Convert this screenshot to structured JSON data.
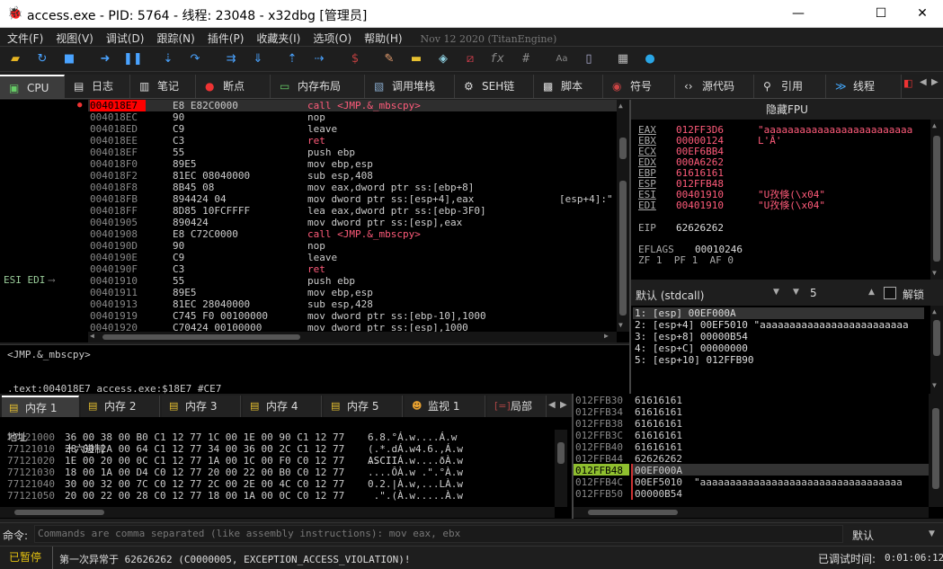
{
  "window": {
    "title": "access.exe - PID: 5764 - 线程: 23048 - x32dbg [管理员]",
    "minimize_glyph": "—",
    "maximize_glyph": "☐",
    "close_glyph": "✕"
  },
  "menu": {
    "items": [
      "文件(F)",
      "视图(V)",
      "调试(D)",
      "跟踪(N)",
      "插件(P)",
      "收藏夹(I)",
      "选项(O)",
      "帮助(H)"
    ],
    "build_date": "Nov 12 2020 (TitanEngine)"
  },
  "toolbar": {
    "icons": [
      "open-icon",
      "restart-icon",
      "stop-icon",
      "run-icon",
      "pause-icon",
      "step-into-icon",
      "step-over-icon",
      "trace-into-icon",
      "trace-over-icon",
      "execute-till-return-icon",
      "run-to-user-code-icon",
      "scylla-icon",
      "patch-icon",
      "comment-icon",
      "label-icon",
      "bookmark-icon",
      "function-icon",
      "hash-icon",
      "font-icon",
      "attach-icon",
      "calculator-icon",
      "globe-icon"
    ],
    "fx_label": "fx",
    "hash_label": "#",
    "font_label": "Aa"
  },
  "tabs": [
    {
      "label": "CPU",
      "icon": "cpu-icon"
    },
    {
      "label": "日志",
      "icon": "log-icon"
    },
    {
      "label": "笔记",
      "icon": "notes-icon"
    },
    {
      "label": "断点",
      "icon": "breakpoint-icon"
    },
    {
      "label": "内存布局",
      "icon": "memory-map-icon"
    },
    {
      "label": "调用堆栈",
      "icon": "call-stack-icon"
    },
    {
      "label": "SEH链",
      "icon": "seh-icon"
    },
    {
      "label": "脚本",
      "icon": "script-icon"
    },
    {
      "label": "符号",
      "icon": "symbol-icon"
    },
    {
      "label": "源代码",
      "icon": "source-icon"
    },
    {
      "label": "引用",
      "icon": "references-icon"
    },
    {
      "label": "线程",
      "icon": "threads-icon"
    }
  ],
  "disasm": {
    "gutter_label": "ESI EDI",
    "rows": [
      {
        "addr": "004018E7",
        "bytes": "E8 E82C0000",
        "ins": "call <JMP.&_mbscpy>",
        "kind": "call"
      },
      {
        "addr": "004018EC",
        "bytes": "90",
        "ins": "nop",
        "kind": ""
      },
      {
        "addr": "004018ED",
        "bytes": "C9",
        "ins": "leave",
        "kind": ""
      },
      {
        "addr": "004018EE",
        "bytes": "C3",
        "ins": "ret",
        "kind": "ret"
      },
      {
        "addr": "004018EF",
        "bytes": "55",
        "ins": "push ebp",
        "kind": ""
      },
      {
        "addr": "004018F0",
        "bytes": "89E5",
        "ins": "mov ebp,esp",
        "kind": ""
      },
      {
        "addr": "004018F2",
        "bytes": "81EC 08040000",
        "ins": "sub esp,408",
        "kind": ""
      },
      {
        "addr": "004018F8",
        "bytes": "8B45 08",
        "ins": "mov eax,dword ptr ss:[ebp+8]",
        "kind": ""
      },
      {
        "addr": "004018FB",
        "bytes": "894424 04",
        "ins": "mov dword ptr ss:[esp+4],eax",
        "kind": "",
        "comment": "[esp+4]:\""
      },
      {
        "addr": "004018FF",
        "bytes": "8D85 10FCFFFF",
        "ins": "lea eax,dword ptr ss:[ebp-3F0]",
        "kind": ""
      },
      {
        "addr": "00401905",
        "bytes": "890424",
        "ins": "mov dword ptr ss:[esp],eax",
        "kind": ""
      },
      {
        "addr": "00401908",
        "bytes": "E8 C72C0000",
        "ins": "call <JMP.&_mbscpy>",
        "kind": "call"
      },
      {
        "addr": "0040190D",
        "bytes": "90",
        "ins": "nop",
        "kind": ""
      },
      {
        "addr": "0040190E",
        "bytes": "C9",
        "ins": "leave",
        "kind": ""
      },
      {
        "addr": "0040190F",
        "bytes": "C3",
        "ins": "ret",
        "kind": "ret"
      },
      {
        "addr": "00401910",
        "bytes": "55",
        "ins": "push ebp",
        "kind": ""
      },
      {
        "addr": "00401911",
        "bytes": "89E5",
        "ins": "mov ebp,esp",
        "kind": ""
      },
      {
        "addr": "00401913",
        "bytes": "81EC 28040000",
        "ins": "sub esp,428",
        "kind": ""
      },
      {
        "addr": "00401919",
        "bytes": "C745 F0 00100000",
        "ins": "mov dword ptr ss:[ebp-10],1000",
        "kind": ""
      },
      {
        "addr": "00401920",
        "bytes": "C70424 00100000",
        "ins": "mov dword ptr ss:[esp],1000",
        "kind": ""
      }
    ]
  },
  "info_box": {
    "line1": "<JMP.&_mbscpy>",
    "line2": ".text:004018E7 access.exe:$18E7 #CE7"
  },
  "registers": {
    "header": "隐藏FPU",
    "rows": [
      {
        "name": "EAX",
        "value": "012FF3D6",
        "str": "\"aaaaaaaaaaaaaaaaaaaaaaaaa"
      },
      {
        "name": "EBX",
        "value": "00000124",
        "str": "L'Ā'"
      },
      {
        "name": "ECX",
        "value": "00EF6BB4",
        "str": ""
      },
      {
        "name": "EDX",
        "value": "000A6262",
        "str": ""
      },
      {
        "name": "EBP",
        "value": "61616161",
        "str": ""
      },
      {
        "name": "ESP",
        "value": "012FFB48",
        "str": ""
      },
      {
        "name": "ESI",
        "value": "00401910",
        "str": "\"U孜倏(\\x04\""
      },
      {
        "name": "EDI",
        "value": "00401910",
        "str": "\"U孜倏(\\x04\""
      }
    ],
    "eip_name": "EIP",
    "eip_value": "62626262",
    "eflags_name": "EFLAGS",
    "eflags_value": "00010246",
    "flags_line": "ZF 1  PF 1  AF 0"
  },
  "callconv": {
    "selected": "默认 (stdcall)",
    "arg_count": "5",
    "unlock_label": "解锁"
  },
  "stack_args": [
    "1: [esp] 00EF000A",
    "2: [esp+4] 00EF5010 \"aaaaaaaaaaaaaaaaaaaaaaaaa",
    "3: [esp+8] 00000B54",
    "4: [esp+C] 00000000",
    "5: [esp+10] 012FFB90"
  ],
  "dump_tabs": [
    {
      "label": "内存 1",
      "icon": "memory-dump-icon"
    },
    {
      "label": "内存 2",
      "icon": "memory-dump-icon"
    },
    {
      "label": "内存 3",
      "icon": "memory-dump-icon"
    },
    {
      "label": "内存 4",
      "icon": "memory-dump-icon"
    },
    {
      "label": "内存 5",
      "icon": "memory-dump-icon"
    },
    {
      "label": "监视 1",
      "icon": "watch-icon"
    },
    {
      "label": "局部",
      "icon": "locals-icon"
    }
  ],
  "dump": {
    "col_addr": "地址",
    "col_hex": "十六进制",
    "col_ascii": "ASCII",
    "rows": [
      {
        "addr": "77121000",
        "hex": "36 00 38 00 B0 C1 12 77 1C 00 1E 00 90 C1 12 77",
        "ascii": "6.8.°Á.w....Á.w"
      },
      {
        "addr": "77121010",
        "hex": "28 00 2A 00 64 C1 12 77 34 00 36 00 2C C1 12 77",
        "ascii": "(.*.dÁ.w4.6.,Á.w"
      },
      {
        "addr": "77121020",
        "hex": "1E 00 20 00 0C C1 12 77 1A 00 1C 00 F0 C0 12 77",
        "ascii": ".. ..Á.w....ðÀ.w"
      },
      {
        "addr": "77121030",
        "hex": "18 00 1A 00 D4 C0 12 77 20 00 22 00 B0 C0 12 77",
        "ascii": "....ÔÀ.w .\".°À.w"
      },
      {
        "addr": "77121040",
        "hex": "30 00 32 00 7C C0 12 77 2C 00 2E 00 4C C0 12 77",
        "ascii": "0.2.|À.w,...LÀ.w"
      },
      {
        "addr": "77121050",
        "hex": "20 00 22 00 28 C0 12 77 18 00 1A 00 0C C0 12 77",
        "ascii": " .\".(À.w.....À.w"
      }
    ]
  },
  "stack": {
    "rows": [
      {
        "addr": "012FFB30",
        "val": "61616161",
        "cmt": ""
      },
      {
        "addr": "012FFB34",
        "val": "61616161",
        "cmt": ""
      },
      {
        "addr": "012FFB38",
        "val": "61616161",
        "cmt": ""
      },
      {
        "addr": "012FFB3C",
        "val": "61616161",
        "cmt": ""
      },
      {
        "addr": "012FFB40",
        "val": "61616161",
        "cmt": ""
      },
      {
        "addr": "012FFB44",
        "val": "62626262",
        "cmt": ""
      },
      {
        "addr": "012FFB48",
        "val": "00EF000A",
        "cmt": ""
      },
      {
        "addr": "012FFB4C",
        "val": "00EF5010",
        "cmt": "\"aaaaaaaaaaaaaaaaaaaaaaaaaaaaaaaaaa"
      },
      {
        "addr": "012FFB50",
        "val": "00000B54",
        "cmt": ""
      }
    ]
  },
  "command": {
    "label": "命令:",
    "placeholder": "Commands are comma separated (like assembly instructions): mov eax, ebx",
    "mode": "默认"
  },
  "status": {
    "state": "已暂停",
    "message": "第一次异常于 62626262 (C0000005, EXCEPTION_ACCESS_VIOLATION)!",
    "time_label": "已调试时间:",
    "time_value": "0:01:06:12"
  },
  "colors": {
    "call_red": "#ff5b7a",
    "rip_highlight": "#ff0000",
    "esp_highlight": "#8fbf2f",
    "paused_yellow": "#e5c210"
  }
}
